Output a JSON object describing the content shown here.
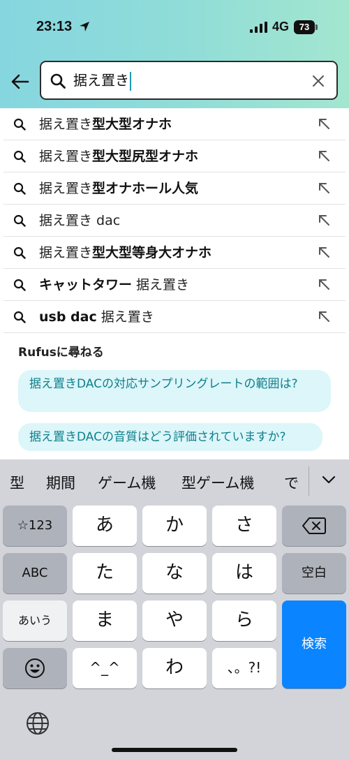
{
  "status_bar": {
    "time": "23:13",
    "network": "4G",
    "battery": "73"
  },
  "search": {
    "value": "据え置き"
  },
  "suggestions": [
    {
      "prefix": "据え置き",
      "suffix": "型大型オナホ"
    },
    {
      "prefix": "据え置き",
      "suffix": "型大型尻型オナホ"
    },
    {
      "prefix": "据え置き",
      "suffix": "型オナホール人気"
    },
    {
      "prefix": "据え置き dac",
      "suffix": ""
    },
    {
      "prefix": "据え置き",
      "suffix": "型大型等身大オナホ"
    },
    {
      "prefix": "キャットタワー",
      "suffix": " 据え置き",
      "bold_first": true
    },
    {
      "prefix": "usb dac",
      "suffix": " 据え置き",
      "bold_first": true
    }
  ],
  "rufus": {
    "heading": "Rufusに尋ねる",
    "questions": [
      "据え置きDACの対応サンプリングレートの範囲は?",
      "据え置きDACの音質はどう評価されていますか?"
    ]
  },
  "keyboard": {
    "candidates": [
      "型",
      "期間",
      "ゲーム機",
      "型ゲーム機",
      "で"
    ],
    "keys": {
      "num": "☆123",
      "abc": "ABC",
      "kana": "あいう",
      "a": "あ",
      "ka": "か",
      "sa": "さ",
      "ta": "た",
      "na": "な",
      "ha": "は",
      "ma": "ま",
      "ya": "や",
      "ra": "ら",
      "emoticon": "^_^",
      "wa": "わ",
      "punct": "、。?!",
      "space": "空白",
      "search": "検索"
    }
  },
  "colors": {
    "accent": "#0a84ff",
    "rufus_text": "#0f7f8c",
    "rufus_bg": "#dcf6f9",
    "header_gradient_start": "#86d6e0",
    "header_gradient_end": "#a3e6d0"
  }
}
